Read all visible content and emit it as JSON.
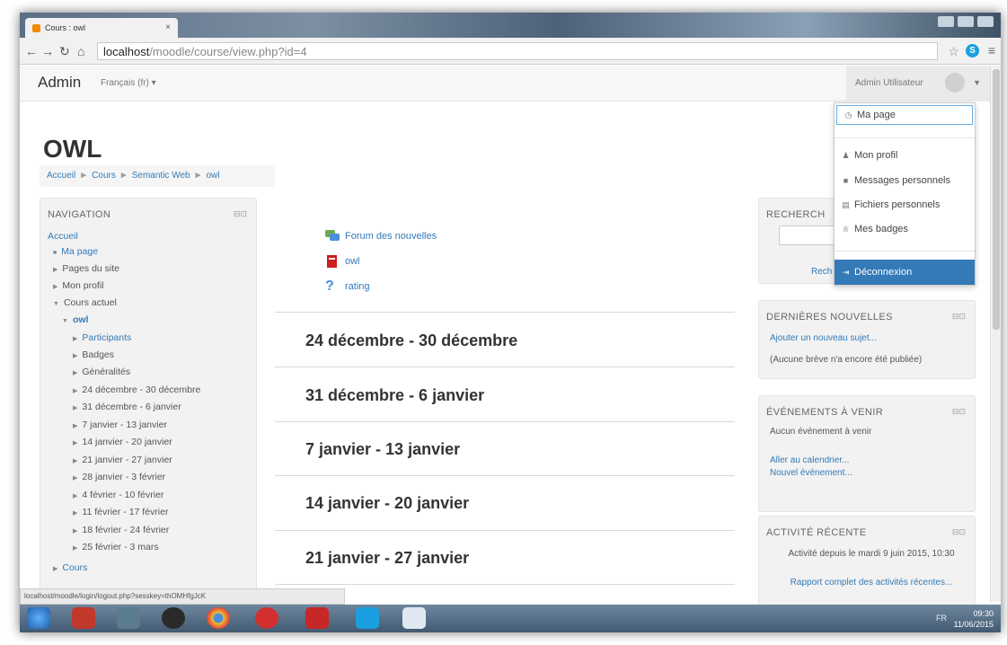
{
  "browser": {
    "tab_title": "Cours : owl",
    "tab_close": "×",
    "url_host": "localhost",
    "url_path": "/moodle/course/view.php?id=4",
    "status_url": "localhost/moodle/login/logout.php?sesskey=thOMHfgJcK"
  },
  "header": {
    "brand": "Admin",
    "language": "Français (fr) ▾",
    "user_name": "Admin Utilisateur"
  },
  "user_dropdown": {
    "items": [
      {
        "label": "Ma page",
        "icon": "dashboard-icon"
      },
      {
        "label": "Mon profil",
        "icon": "user-icon"
      },
      {
        "label": "Messages personnels",
        "icon": "chat-icon"
      },
      {
        "label": "Fichiers personnels",
        "icon": "file-icon"
      },
      {
        "label": "Mes badges",
        "icon": "trophy-icon"
      },
      {
        "label": "Déconnexion",
        "icon": "logout-icon"
      }
    ]
  },
  "page": {
    "title": "OWL",
    "breadcrumb": [
      "Accueil",
      "Cours",
      "Semantic Web",
      "owl"
    ]
  },
  "navigation": {
    "heading": "NAVIGATION",
    "items": [
      {
        "label": "Accueil"
      },
      {
        "label": "Ma page"
      },
      {
        "label": "Pages du site"
      },
      {
        "label": "Mon profil"
      },
      {
        "label": "Cours actuel"
      },
      {
        "label": "owl"
      },
      {
        "label": "Participants"
      },
      {
        "label": "Badges"
      },
      {
        "label": "Généralités"
      },
      {
        "label": "24 décembre - 30 décembre"
      },
      {
        "label": "31 décembre - 6 janvier"
      },
      {
        "label": "7 janvier - 13 janvier"
      },
      {
        "label": "14 janvier - 20 janvier"
      },
      {
        "label": "21 janvier - 27 janvier"
      },
      {
        "label": "28 janvier - 3 février"
      },
      {
        "label": "4 février - 10 février"
      },
      {
        "label": "11 février - 17 février"
      },
      {
        "label": "18 février - 24 février"
      },
      {
        "label": "25 février - 3 mars"
      },
      {
        "label": "Cours"
      }
    ]
  },
  "activities": [
    {
      "label": "Forum des nouvelles",
      "icon": "forum-icon"
    },
    {
      "label": "owl",
      "icon": "pdf-icon"
    },
    {
      "label": "rating",
      "icon": "question-icon"
    }
  ],
  "weeks": [
    "24 décembre - 30 décembre",
    "31 décembre - 6 janvier",
    "7 janvier - 13 janvier",
    "14 janvier - 20 janvier",
    "21 janvier - 27 janvier"
  ],
  "blocks": {
    "search": {
      "heading": "RECHERCH",
      "button": "Rech"
    },
    "news": {
      "heading": "DERNIÈRES NOUVELLES",
      "add_link": "Ajouter un nouveau sujet...",
      "empty": "(Aucune brève n'a encore été publiée)"
    },
    "events": {
      "heading": "ÉVÉNEMENTS À VENIR",
      "empty": "Aucun événement à venir",
      "calendar_link": "Aller au calendrier...",
      "new_event_link": "Nouvel événement..."
    },
    "recent": {
      "heading": "ACTIVITÉ RÉCENTE",
      "since": "Activité depuis le mardi 9 juin 2015, 10:30",
      "report_link": "Rapport complet des activités récentes..."
    }
  },
  "taskbar": {
    "lang": "FR",
    "time": "09:30",
    "date": "11/06/2015"
  }
}
